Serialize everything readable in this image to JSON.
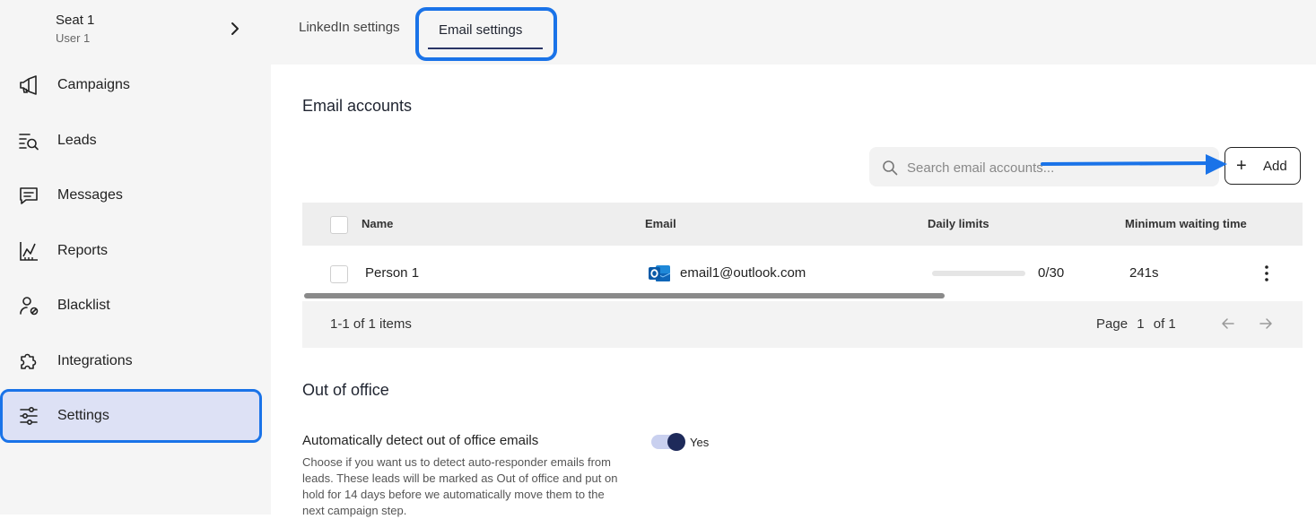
{
  "sidebar": {
    "seat_name": "Seat 1",
    "seat_user": "User 1",
    "items": [
      {
        "label": "Campaigns",
        "icon": "megaphone-icon"
      },
      {
        "label": "Leads",
        "icon": "list-search-icon"
      },
      {
        "label": "Messages",
        "icon": "chat-icon"
      },
      {
        "label": "Reports",
        "icon": "chart-icon"
      },
      {
        "label": "Blacklist",
        "icon": "user-block-icon"
      },
      {
        "label": "Integrations",
        "icon": "puzzle-icon"
      },
      {
        "label": "Settings",
        "icon": "sliders-icon",
        "active": true
      }
    ]
  },
  "tabs": {
    "linkedin": "LinkedIn settings",
    "email": "Email settings"
  },
  "email_accounts": {
    "title": "Email accounts",
    "search_placeholder": "Search email accounts...",
    "add_label": "Add",
    "columns": {
      "name": "Name",
      "email": "Email",
      "daily_limits": "Daily limits",
      "min_wait": "Minimum waiting time"
    },
    "rows": [
      {
        "name": "Person 1",
        "email": "email1@outlook.com",
        "daily_limit": "0/30",
        "daily_progress": 0,
        "min_wait": "241s"
      }
    ],
    "footer": {
      "count": "1-1 of 1 items",
      "page_label": "Page",
      "page_current": "1",
      "page_of": "of 1"
    }
  },
  "out_of_office": {
    "title": "Out of office",
    "label": "Automatically detect out of office emails",
    "description": "Choose if you want us to detect auto-responder emails from leads. These leads will be marked as Out of office and put on hold for 14 days before we automatically move them to the next campaign step.",
    "toggle_value": "Yes"
  },
  "colors": {
    "accent_blue": "#1a73e8",
    "navy": "#2a3566",
    "active_bg": "#dde1f5"
  }
}
